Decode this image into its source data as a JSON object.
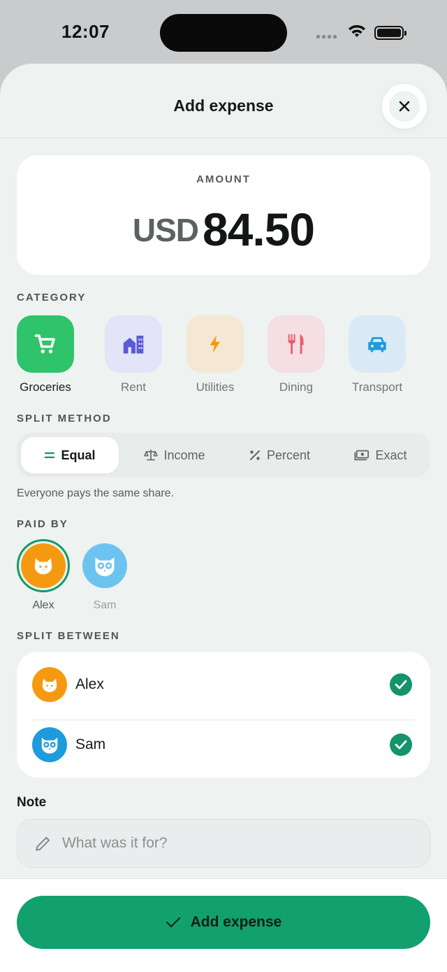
{
  "status_bar": {
    "time": "12:07"
  },
  "sheet": {
    "title": "Add expense"
  },
  "amount": {
    "label": "AMOUNT",
    "currency": "USD",
    "value": "84.50"
  },
  "category": {
    "label": "CATEGORY",
    "items": [
      {
        "name": "Groceries",
        "icon": "cart-icon",
        "color": "#2fc36b",
        "active": true
      },
      {
        "name": "Rent",
        "icon": "building-icon",
        "color": "#5b5bd6",
        "active": false
      },
      {
        "name": "Utilities",
        "icon": "bolt-icon",
        "color": "#f29a16",
        "active": false
      },
      {
        "name": "Dining",
        "icon": "utensils-icon",
        "color": "#ee5b6c",
        "active": false
      },
      {
        "name": "Transport",
        "icon": "car-icon",
        "color": "#1e9bdc",
        "active": false
      }
    ]
  },
  "split_method": {
    "label": "SPLIT METHOD",
    "options": [
      {
        "label": "Equal",
        "icon": "equals-icon",
        "active": true
      },
      {
        "label": "Income",
        "icon": "scale-icon",
        "active": false
      },
      {
        "label": "Percent",
        "icon": "percent-icon",
        "active": false
      },
      {
        "label": "Exact",
        "icon": "cash-icon",
        "active": false
      }
    ],
    "hint": "Everyone pays the same share."
  },
  "paid_by": {
    "label": "PAID BY",
    "people": [
      {
        "name": "Alex",
        "avatar": "cat-icon",
        "color": "#f59a10",
        "selected": true
      },
      {
        "name": "Sam",
        "avatar": "owl-icon",
        "color": "#6cc3f0",
        "selected": false
      }
    ]
  },
  "split_between": {
    "label": "SPLIT BETWEEN",
    "members": [
      {
        "name": "Alex",
        "avatar": "cat-icon",
        "color": "#f59a10",
        "checked": true
      },
      {
        "name": "Sam",
        "avatar": "owl-icon",
        "color": "#1e9bdc",
        "checked": true
      }
    ]
  },
  "note": {
    "label": "Note",
    "placeholder": "What was it for?",
    "value": ""
  },
  "cta": {
    "label": "Add expense"
  },
  "colors": {
    "accent": "#12a06f",
    "check": "#13946a",
    "background": "#eef2f1"
  }
}
